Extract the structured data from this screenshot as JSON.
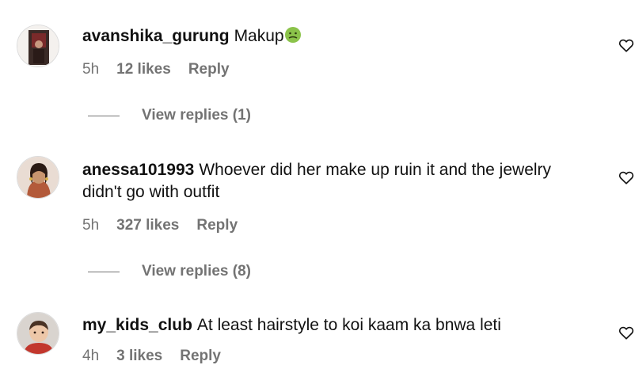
{
  "comments": [
    {
      "username": "avanshika_gurung",
      "text": "Makup",
      "emoji": "nauseated-face-icon",
      "time": "5h",
      "likes": "12 likes",
      "reply": "Reply",
      "view_replies": "View replies (1)"
    },
    {
      "username": "anessa101993",
      "text": "Whoever did her make up ruin it and the jewelry didn't go with outfit",
      "time": "5h",
      "likes": "327 likes",
      "reply": "Reply",
      "view_replies": "View replies (8)"
    },
    {
      "username": "my_kids_club",
      "text": "At least hairstyle to koi kaam ka bnwa leti",
      "time": "4h",
      "likes": "3 likes",
      "reply": "Reply"
    }
  ],
  "colors": {
    "text": "#111111",
    "muted": "#737373",
    "divider": "#dbdbdb"
  }
}
